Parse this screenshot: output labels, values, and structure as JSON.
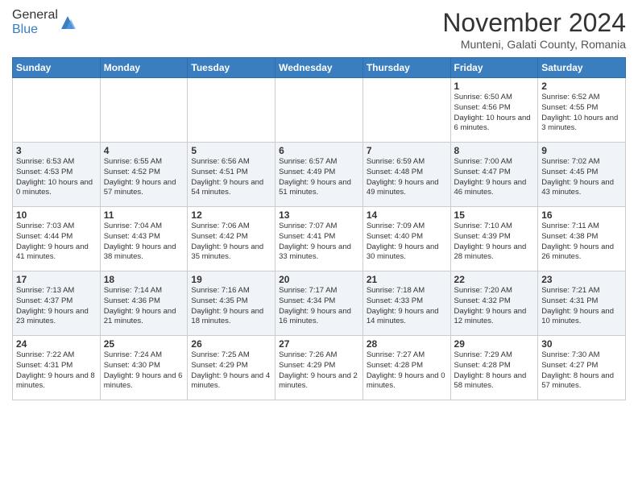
{
  "header": {
    "logo_general": "General",
    "logo_blue": "Blue",
    "month_title": "November 2024",
    "location": "Munteni, Galati County, Romania"
  },
  "weekdays": [
    "Sunday",
    "Monday",
    "Tuesday",
    "Wednesday",
    "Thursday",
    "Friday",
    "Saturday"
  ],
  "weeks": [
    {
      "days": [
        {
          "num": "",
          "info": ""
        },
        {
          "num": "",
          "info": ""
        },
        {
          "num": "",
          "info": ""
        },
        {
          "num": "",
          "info": ""
        },
        {
          "num": "",
          "info": ""
        },
        {
          "num": "1",
          "info": "Sunrise: 6:50 AM\nSunset: 4:56 PM\nDaylight: 10 hours and 6 minutes."
        },
        {
          "num": "2",
          "info": "Sunrise: 6:52 AM\nSunset: 4:55 PM\nDaylight: 10 hours and 3 minutes."
        }
      ]
    },
    {
      "days": [
        {
          "num": "3",
          "info": "Sunrise: 6:53 AM\nSunset: 4:53 PM\nDaylight: 10 hours and 0 minutes."
        },
        {
          "num": "4",
          "info": "Sunrise: 6:55 AM\nSunset: 4:52 PM\nDaylight: 9 hours and 57 minutes."
        },
        {
          "num": "5",
          "info": "Sunrise: 6:56 AM\nSunset: 4:51 PM\nDaylight: 9 hours and 54 minutes."
        },
        {
          "num": "6",
          "info": "Sunrise: 6:57 AM\nSunset: 4:49 PM\nDaylight: 9 hours and 51 minutes."
        },
        {
          "num": "7",
          "info": "Sunrise: 6:59 AM\nSunset: 4:48 PM\nDaylight: 9 hours and 49 minutes."
        },
        {
          "num": "8",
          "info": "Sunrise: 7:00 AM\nSunset: 4:47 PM\nDaylight: 9 hours and 46 minutes."
        },
        {
          "num": "9",
          "info": "Sunrise: 7:02 AM\nSunset: 4:45 PM\nDaylight: 9 hours and 43 minutes."
        }
      ]
    },
    {
      "days": [
        {
          "num": "10",
          "info": "Sunrise: 7:03 AM\nSunset: 4:44 PM\nDaylight: 9 hours and 41 minutes."
        },
        {
          "num": "11",
          "info": "Sunrise: 7:04 AM\nSunset: 4:43 PM\nDaylight: 9 hours and 38 minutes."
        },
        {
          "num": "12",
          "info": "Sunrise: 7:06 AM\nSunset: 4:42 PM\nDaylight: 9 hours and 35 minutes."
        },
        {
          "num": "13",
          "info": "Sunrise: 7:07 AM\nSunset: 4:41 PM\nDaylight: 9 hours and 33 minutes."
        },
        {
          "num": "14",
          "info": "Sunrise: 7:09 AM\nSunset: 4:40 PM\nDaylight: 9 hours and 30 minutes."
        },
        {
          "num": "15",
          "info": "Sunrise: 7:10 AM\nSunset: 4:39 PM\nDaylight: 9 hours and 28 minutes."
        },
        {
          "num": "16",
          "info": "Sunrise: 7:11 AM\nSunset: 4:38 PM\nDaylight: 9 hours and 26 minutes."
        }
      ]
    },
    {
      "days": [
        {
          "num": "17",
          "info": "Sunrise: 7:13 AM\nSunset: 4:37 PM\nDaylight: 9 hours and 23 minutes."
        },
        {
          "num": "18",
          "info": "Sunrise: 7:14 AM\nSunset: 4:36 PM\nDaylight: 9 hours and 21 minutes."
        },
        {
          "num": "19",
          "info": "Sunrise: 7:16 AM\nSunset: 4:35 PM\nDaylight: 9 hours and 18 minutes."
        },
        {
          "num": "20",
          "info": "Sunrise: 7:17 AM\nSunset: 4:34 PM\nDaylight: 9 hours and 16 minutes."
        },
        {
          "num": "21",
          "info": "Sunrise: 7:18 AM\nSunset: 4:33 PM\nDaylight: 9 hours and 14 minutes."
        },
        {
          "num": "22",
          "info": "Sunrise: 7:20 AM\nSunset: 4:32 PM\nDaylight: 9 hours and 12 minutes."
        },
        {
          "num": "23",
          "info": "Sunrise: 7:21 AM\nSunset: 4:31 PM\nDaylight: 9 hours and 10 minutes."
        }
      ]
    },
    {
      "days": [
        {
          "num": "24",
          "info": "Sunrise: 7:22 AM\nSunset: 4:31 PM\nDaylight: 9 hours and 8 minutes."
        },
        {
          "num": "25",
          "info": "Sunrise: 7:24 AM\nSunset: 4:30 PM\nDaylight: 9 hours and 6 minutes."
        },
        {
          "num": "26",
          "info": "Sunrise: 7:25 AM\nSunset: 4:29 PM\nDaylight: 9 hours and 4 minutes."
        },
        {
          "num": "27",
          "info": "Sunrise: 7:26 AM\nSunset: 4:29 PM\nDaylight: 9 hours and 2 minutes."
        },
        {
          "num": "28",
          "info": "Sunrise: 7:27 AM\nSunset: 4:28 PM\nDaylight: 9 hours and 0 minutes."
        },
        {
          "num": "29",
          "info": "Sunrise: 7:29 AM\nSunset: 4:28 PM\nDaylight: 8 hours and 58 minutes."
        },
        {
          "num": "30",
          "info": "Sunrise: 7:30 AM\nSunset: 4:27 PM\nDaylight: 8 hours and 57 minutes."
        }
      ]
    }
  ]
}
